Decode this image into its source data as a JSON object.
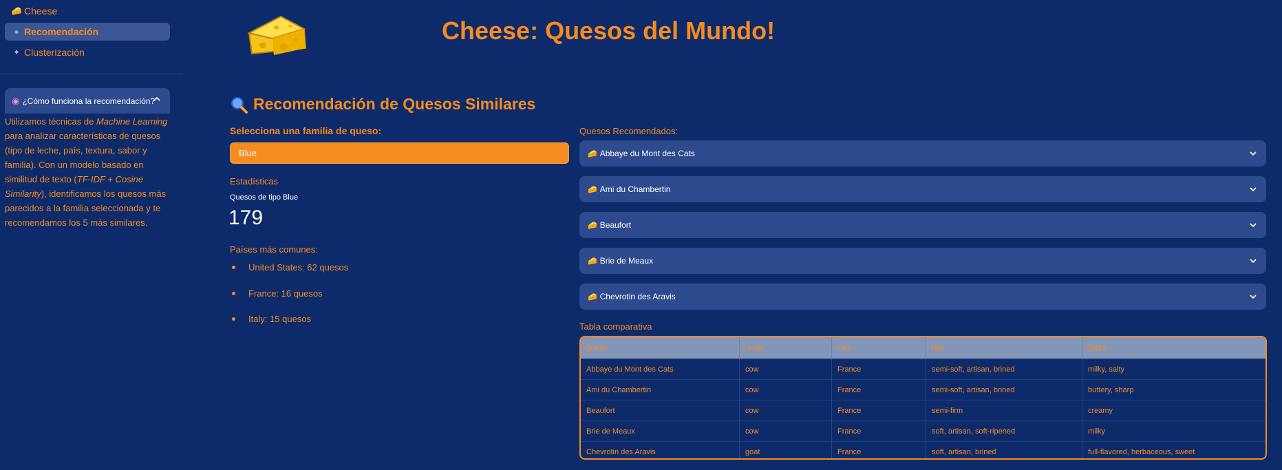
{
  "sidebar": {
    "nav": [
      {
        "icon": "cheese-icon",
        "label": "Cheese",
        "active": false
      },
      {
        "icon": "crystal-ball-icon",
        "label": "Recomendación",
        "active": true
      },
      {
        "icon": "sparkles-icon",
        "label": "Clusterización",
        "active": false
      }
    ],
    "expander": {
      "title": "¿Cómo funciona la recomendación?",
      "body_parts": [
        "Utilizamos técnicas de ",
        "Machine Learning",
        " para analizar características de quesos (tipo de leche, país, textura, sabor y familia). Con un modelo basado en similitud de texto (",
        "TF-IDF + Cosine Similarity",
        "), identificamos los quesos más parecidos a la familia seleccionada y te recomendamos los 5 más similares."
      ]
    }
  },
  "header": {
    "title": "Cheese: Quesos del Mundo!"
  },
  "main": {
    "section_title": "Recomendación de Quesos Similares",
    "select_label": "Selecciona una familia de queso:",
    "selected_family": "Blue",
    "stats_title": "Estadísticas",
    "metric_label": "Quesos de tipo Blue",
    "metric_value": "179",
    "countries_title": "Países más comunes:",
    "countries": [
      "United States: 62 quesos",
      "France: 16 quesos",
      "Italy: 15 quesos"
    ],
    "recommended_title": "Quesos Recomendados:",
    "recommended": [
      "Abbaye du Mont des Cats",
      "Ami du Chambertin",
      "Beaufort",
      "Brie de Meaux",
      "Chevrotin des Aravis"
    ],
    "table_title": "Tabla comparativa",
    "table": {
      "headers": [
        "Queso",
        "Leche",
        "País",
        "Tipo",
        "Sabor"
      ],
      "rows": [
        [
          "Abbaye du Mont des Cats",
          "cow",
          "France",
          "semi-soft, artisan, brined",
          "milky, salty"
        ],
        [
          "Ami du Chambertin",
          "cow",
          "France",
          "semi-soft, artisan, brined",
          "buttery, sharp"
        ],
        [
          "Beaufort",
          "cow",
          "France",
          "semi-firm",
          "creamy"
        ],
        [
          "Brie de Meaux",
          "cow",
          "France",
          "soft, artisan, soft-ripened",
          "milky"
        ],
        [
          "Chevrotin des Aravis",
          "goat",
          "France",
          "soft, artisan, brined",
          "full-flavored, herbaceous, sweet"
        ]
      ]
    }
  },
  "colors": {
    "background": "#0d2b6b",
    "accent": "#f68b1f",
    "panel": "#2d4a8e",
    "active_nav": "#3b5694",
    "table_header": "#8496b8"
  }
}
